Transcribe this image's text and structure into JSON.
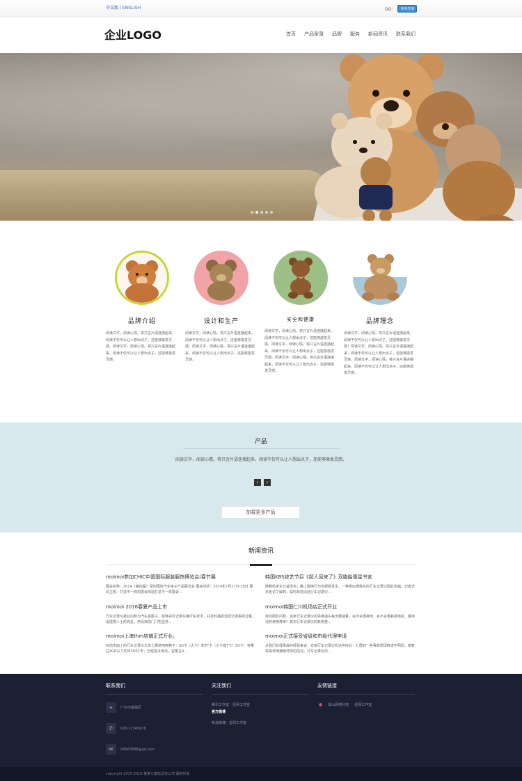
{
  "topbar": {
    "lang": "中文版 | ENGLISH",
    "qq_label": "QQ：",
    "qq_badge": "在线交谈"
  },
  "header": {
    "logo": "企业LOGO",
    "nav": [
      "首页",
      "产品型录",
      "品牌",
      "服务",
      "新闻资讯",
      "联系我们"
    ]
  },
  "banner": {
    "dots": 5,
    "active_dot": 2
  },
  "features": [
    {
      "title": "品牌介绍",
      "circle_color": "#c5d630",
      "desc": "阅读文字，阅读心情。将只言片语连接起来，阅读不仅可以让人想出点子，还能够激发灵感。阅读文字，阅读心情。将只言片语连接起来，阅读不仅可以让人想出点子，还能够激发灵感。"
    },
    {
      "title": "设计和生产",
      "circle_color": "#f2a3a8",
      "desc": "阅读文字，阅读心情。将只言片语连接起来，阅读不仅可以让人想出点子，还能够激发灵感。阅读文字，阅读心情。将只言片语连接起来，阅读不仅可以让人想出点子，还能够激发灵感。"
    },
    {
      "title": "安全和健康",
      "circle_color": "#9cbf86",
      "desc": "阅读文字，阅读心情。将只言片语连接起来，阅读不仅可以让人想出点子，还能够激发灵感。阅读文字，阅读心情。将只言片语连接起来，阅读不仅可以让人想出点子，还能够激发灵感。阅读文字，阅读心情。将只言片语连接起来，阅读不仅可以让人想出点子，还能够激发灵感。"
    },
    {
      "title": "品牌理念",
      "circle_color": "#a8c8dc",
      "desc": "阅读文字，阅读心情。将只言片语连接起来，阅读不仅可以让人想出点子，还能够激发灵感！阅读文字，阅读心情。将只言片语连接起来，阅读不仅可以让人想出点子，还能够激发灵感。阅读文字，阅读心情。将只言片语连接起来，阅读不仅可以让人想出点子，还能够激发灵感。"
    }
  ],
  "products": {
    "title": "产品",
    "desc": "阅读文字，阅读心情。将只言片语连接起来，阅读不仅可以让人想出点子，还能够激发灵感。",
    "prev": "‹",
    "next": "›",
    "more": "加载更多产品"
  },
  "news": {
    "title": "新闻资讯",
    "items": [
      {
        "title": "moimoi参加CHIC中国国际服装服饰博览会(春节展",
        "body": "展会名称：2014（第四届）深圳国际汽车电子产品展览会 展会时间：2014年7月17日-19日 展会主题：打造不一样的展会体验打造不一样展会..."
      },
      {
        "title": "韩国KBS综艺节目《超人回来了》双胞胎童星书言",
        "body": "随着私家车日益增多，路上碰擦行为也频频发生，一种类似摄像头的行车记录仪因此热销。记者近日走访了解到，是时目前清远行车记录仪..."
      },
      {
        "title": "moimoi 2016春夏产品上市",
        "body": "行车记录仪被业内称为汽车黑匣子，能够实时记录车辆行车状况，并及时捕捉还原交通事故过程，是碰撞人士的克星，然而目前门门吃坚持..."
      },
      {
        "title": "moimoi韩国仁川机场店正式开业",
        "body": "有的朋友问我，自家行车记录仪的供电插头每天都插着，会不会很耗电，会不会很耗损电机、蓄电池的使用寿命？其实行车记录仪的耗电量..."
      },
      {
        "title": "moimoi上海thm店铺正式开业。",
        "body": "目前市面上的行车记录仪大体上都使用两种卡：SD卡（大卡）和TF卡（小卡或T卡）SD卡：容量在4GB以下的叫SDSC卡，已经基本淘汰。容量在4..."
      },
      {
        "title": "moimoi正式接受省级和市级代理申请",
        "body": "从我们处理事故的经验来说，安装行车记录仪有这些好处：1.遇到一些事故现场痕迹不明显，或者事故现场被破坏掉的情况，行车记录仪的..."
      }
    ]
  },
  "footer": {
    "contact": {
      "heading": "联系我们",
      "address": "广州市番禺区",
      "phone": "020-12345678",
      "email": "94583888@qq.com"
    },
    "follow": {
      "heading": "关注我们",
      "line1": "腾讯工作室：星网工作室",
      "line1b": "官方微博",
      "line2": "新浪微博：星网工作室"
    },
    "links": {
      "heading": "友情链接",
      "items": [
        "鼎山网络科技",
        "星网工作室"
      ]
    },
    "copyright": "copyright 2015-2018 某某儿童玩具有公司 版权所有"
  },
  "colors": {
    "footer_bg": "#1c2033",
    "products_bg": "#d8e8ec",
    "link_accent": "#3a6fb5"
  }
}
